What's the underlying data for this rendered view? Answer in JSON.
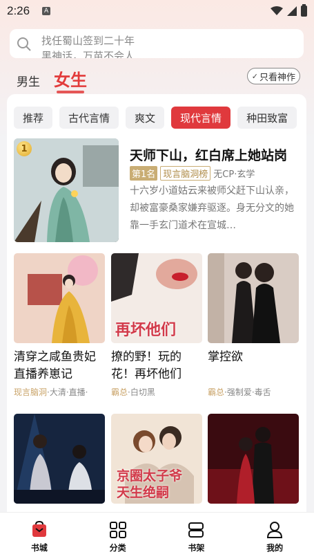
{
  "status": {
    "time": "2:26",
    "notif": "A"
  },
  "search": {
    "placeholder_line1": "找任蜀山签到二十年",
    "placeholder_line2": "黑神话，万苗不会人"
  },
  "gender": {
    "male": "男生",
    "female": "女生",
    "only_god": "只看神作"
  },
  "categories": [
    "推荐",
    "古代言情",
    "爽文",
    "现代言情",
    "种田致富"
  ],
  "active_category": "现代言情",
  "featured": {
    "rank_badge": "1",
    "title": "天师下山，红白席上她站岗",
    "rank": "第1名",
    "rank_list": "现言脑洞榜",
    "meta": "无CP·玄学",
    "description": "十六岁小道姑云来被师父赶下山认亲，却被富豪桑家嫌弃驱逐。身无分文的她靠一手玄门道术在宣城…"
  },
  "books": [
    {
      "title": "清穿之咸鱼贵妃直播养崽记",
      "tag_first": "现言脑洞",
      "tag_rest": "·大清·直播·"
    },
    {
      "title": "撩的野！玩的花！再坏他们",
      "tag_first": "霸总",
      "tag_rest": "·白切黑",
      "cover_text": "再坏他们"
    },
    {
      "title": "掌控欲",
      "tag_first": "霸总",
      "tag_rest": "·强制爱·毒舌"
    },
    {
      "cover_text": ""
    },
    {
      "cover_text": "京圈太子爷 天生绝嗣"
    },
    {
      "cover_text": ""
    }
  ],
  "nav": [
    {
      "label": "书城",
      "icon": "bookstore-icon"
    },
    {
      "label": "分类",
      "icon": "grid-icon"
    },
    {
      "label": "书架",
      "icon": "bookshelf-icon"
    },
    {
      "label": "我的",
      "icon": "user-icon"
    }
  ],
  "colors": {
    "accent": "#e0393d",
    "gold": "#c9ad74"
  }
}
